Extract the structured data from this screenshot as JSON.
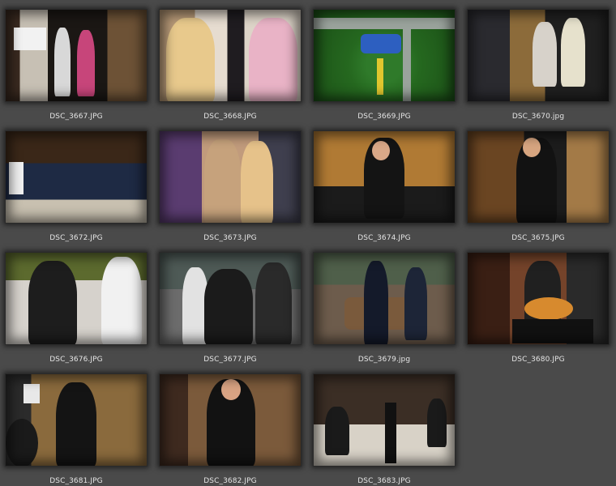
{
  "photos": [
    {
      "filename": "DSC_3667.JPG"
    },
    {
      "filename": "DSC_3668.JPG"
    },
    {
      "filename": "DSC_3669.JPG"
    },
    {
      "filename": "DSC_3670.jpg"
    },
    {
      "filename": "DSC_3672.JPG"
    },
    {
      "filename": "DSC_3673.JPG"
    },
    {
      "filename": "DSC_3674.JPG"
    },
    {
      "filename": "DSC_3675.JPG"
    },
    {
      "filename": "DSC_3676.JPG"
    },
    {
      "filename": "DSC_3677.JPG"
    },
    {
      "filename": "DSC_3679.jpg"
    },
    {
      "filename": "DSC_3680.JPG"
    },
    {
      "filename": "DSC_3681.JPG"
    },
    {
      "filename": "DSC_3682.JPG"
    },
    {
      "filename": "DSC_3683.JPG"
    }
  ],
  "colors": {
    "background": "#4a4a4a",
    "caption_text": "#e4e4e4"
  }
}
